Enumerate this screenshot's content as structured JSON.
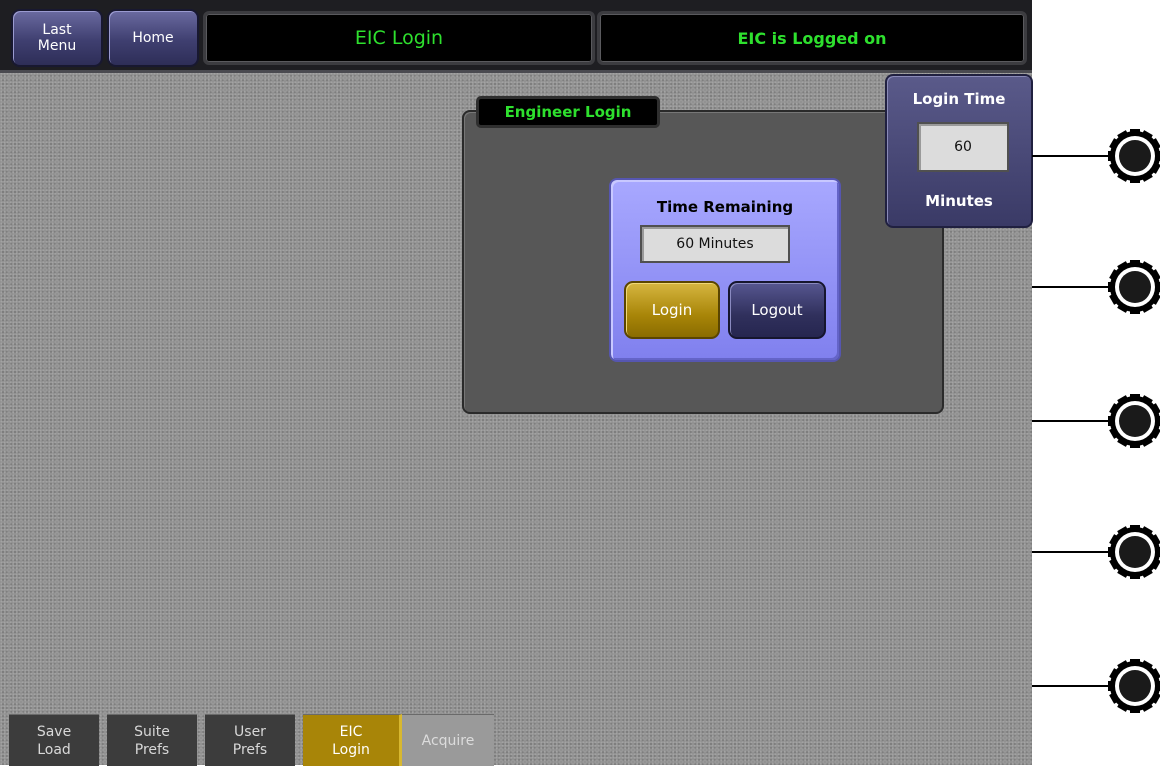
{
  "header": {
    "last_menu_label": "Last\nMenu",
    "home_label": "Home",
    "title": "EIC Login",
    "status": "EIC is Logged on"
  },
  "panel": {
    "tab_title": "Engineer Login",
    "time_remaining_label": "Time Remaining",
    "time_remaining_value": "60 Minutes",
    "login_label": "Login",
    "logout_label": "Logout"
  },
  "login_time": {
    "label": "Login Time",
    "value": "60",
    "unit": "Minutes"
  },
  "bottom_tabs": [
    {
      "label": "Save\nLoad"
    },
    {
      "label": "Suite\nPrefs"
    },
    {
      "label": "User\nPrefs"
    },
    {
      "label": "EIC\nLogin"
    },
    {
      "label": "Acquire"
    }
  ],
  "knobs": [
    "knob-1",
    "knob-2",
    "knob-3",
    "knob-4",
    "knob-5"
  ],
  "colors": {
    "accent_green": "#2ee02e",
    "active_gold": "#a88508",
    "panel_blue": "#8c8cf2"
  }
}
